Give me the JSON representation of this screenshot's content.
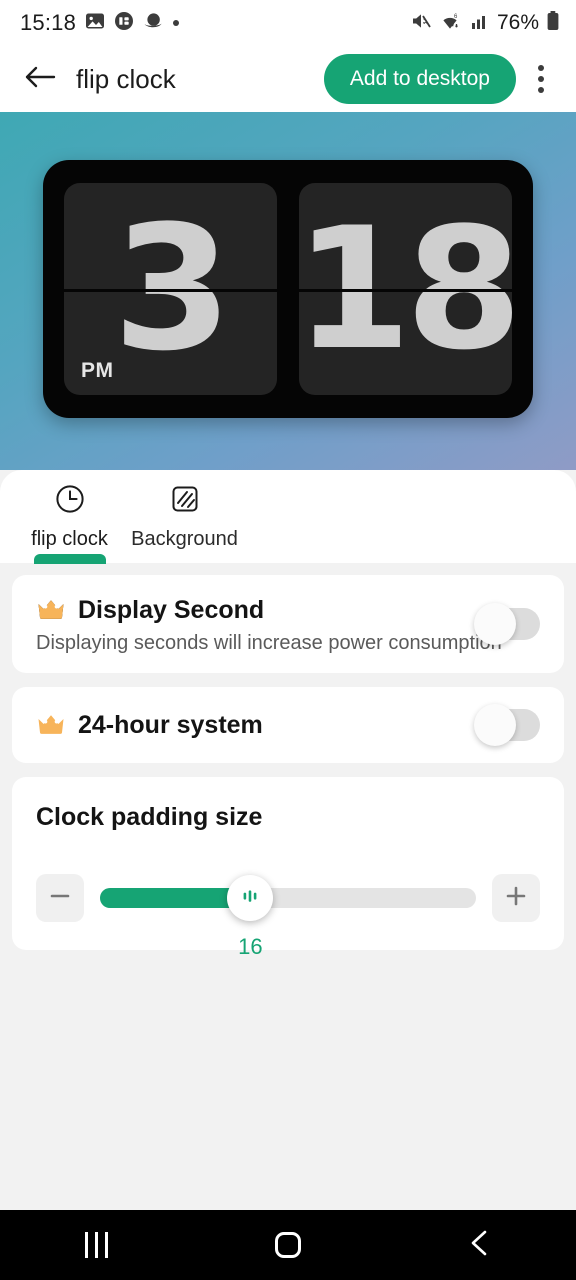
{
  "status_bar": {
    "time": "15:18",
    "battery_text": "76%",
    "icons": [
      "image-icon",
      "app-badge-icon",
      "saturn-icon",
      "dot-icon",
      "mute-icon",
      "wifi-icon",
      "signal-icon",
      "battery-icon"
    ]
  },
  "app_bar": {
    "back_icon": "arrow-left-icon",
    "title": "flip clock",
    "add_label": "Add to desktop",
    "menu_icon": "kebab-menu-icon",
    "accent": "#16a474"
  },
  "preview": {
    "hour": "3",
    "minute": "18",
    "meridiem": "PM",
    "widget_bg": "#050505",
    "card_bg": "#242424",
    "digit_color": "#cfcfcf"
  },
  "tabs": [
    {
      "label": "flip clock",
      "icon": "clock-icon",
      "active": true
    },
    {
      "label": "Background",
      "icon": "pattern-square-icon",
      "active": false
    }
  ],
  "settings": {
    "display_second": {
      "icon": "crown-icon",
      "title": "Display Second",
      "subtitle": "Displaying seconds will increase power consumption",
      "toggle_on": false
    },
    "hour_system": {
      "icon": "crown-icon",
      "title": "24-hour system",
      "toggle_on": false
    },
    "padding": {
      "title": "Clock padding size",
      "value": "16",
      "percent": 40,
      "minus_icon": "minus-icon",
      "plus_icon": "plus-icon",
      "thumb_icon": "slider-bars-icon"
    }
  },
  "nav_bar": {
    "recents_icon": "recents-icon",
    "home_icon": "home-icon",
    "back_icon": "back-chevron-icon"
  }
}
